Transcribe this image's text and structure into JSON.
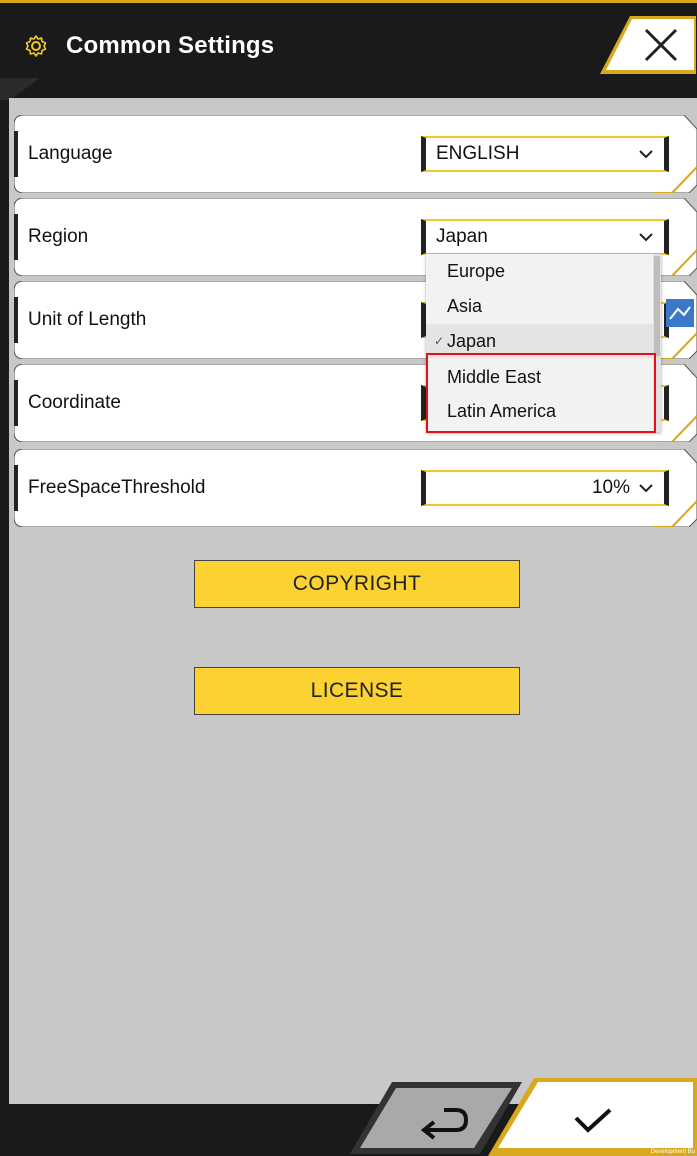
{
  "header": {
    "title": "Common Settings",
    "icon": "gear-icon"
  },
  "settings": [
    {
      "label": "Language",
      "value": "ENGLISH"
    },
    {
      "label": "Region",
      "value": "Japan"
    },
    {
      "label": "Unit of Length",
      "value": ""
    },
    {
      "label": "Coordinate",
      "value": ""
    },
    {
      "label": "FreeSpaceThreshold",
      "value": "10%"
    }
  ],
  "region_dropdown": {
    "options": [
      "Europe",
      "Asia",
      "Japan",
      "Middle East",
      "Latin America"
    ],
    "selected": "Japan",
    "check_glyph": "✓"
  },
  "buttons": {
    "copyright": "COPYRIGHT",
    "license": "LICENSE"
  },
  "footer": {
    "dev_text": "Development Bu"
  },
  "colors": {
    "accent_yellow": "#fcd232",
    "border_yellow": "#f0c82a",
    "highlight_red": "#e0101c",
    "header_bg": "#1a1a1a",
    "content_bg": "#c8c8c8"
  }
}
